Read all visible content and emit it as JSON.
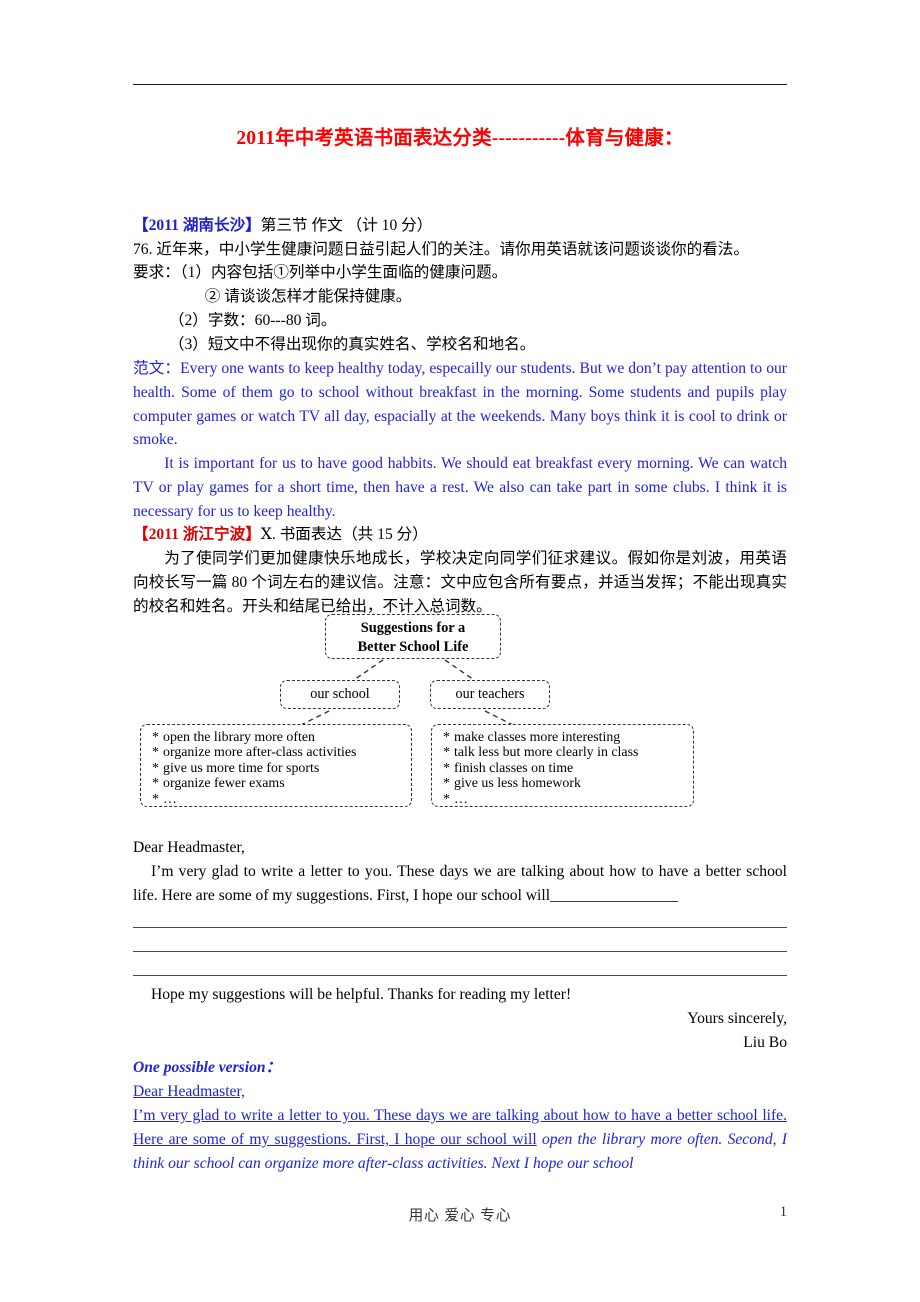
{
  "document": {
    "title": "2011年中考英语书面表达分类-----------体育与健康：",
    "title_color": "#ff0000"
  },
  "section_changsha": {
    "tag": "【2011 湖南长沙】",
    "tag_color": "#1f1fc8",
    "heading_rest": "第三节 作文 （计 10 分）",
    "prompt": "76. 近年来，中小学生健康问题日益引起人们的关注。请你用英语就该问题谈谈你的看法。",
    "req_intro": "要求：（1）内容包括①列举中小学生面临的健康问题。",
    "req_2": "② 请谈谈怎样才能保持健康。",
    "req_3": "（2）字数：60---80 词。",
    "req_4": "（3）短文中不得出现你的真实姓名、学校名和地名。",
    "sample_label": "范文：",
    "sample_para1": "Every one wants to keep healthy today, especailly our students. But we don’t pay attention to our health. Some of them go to school without breakfast in the morning. Some students and pupils play computer games or watch TV all day, espacially at the weekends. Many boys think it is cool to drink or smoke.",
    "sample_para2": "It is important for us to have good habbits. We should eat breakfast every morning. We can watch TV or play games for a short time, then have a rest. We also can take part in some clubs. I think it is necessary for us to keep healthy."
  },
  "section_ningbo": {
    "tag": "【2011 浙江宁波】",
    "tag_color": "#e00000",
    "heading_rest": "Ⅹ. 书面表达（共 15 分）",
    "prompt": "为了使同学们更加健康快乐地成长，学校决定向同学们征求建议。假如你是刘波，用英语向校长写一篇 80 个词左右的建议信。注意：文中应包含所有要点，并适当发挥；不能出现真实的校名和姓名。开头和结尾已给出，不计入总词数。",
    "diagram": {
      "title_line1": "Suggestions for a",
      "title_line2": "Better School Life",
      "node_school": "our school",
      "node_teachers": "our teachers",
      "school_items": [
        "open the library more often",
        "organize more after-class activities",
        "give us more time for sports",
        "organize fewer exams",
        "…"
      ],
      "teacher_items": [
        "make classes more interesting",
        "talk less but more clearly in class",
        "finish classes on time",
        "give us less homework",
        "…"
      ],
      "bullet_marker": "*"
    },
    "letter": {
      "salutation": "Dear Headmaster,",
      "body": "I’m very glad to write a letter to you. These days we are talking about how to have a better school life. Here are some of my suggestions. First, I hope our school will",
      "blank_count": 3,
      "closing_line": "Hope my suggestions will be helpful. Thanks for reading my letter!",
      "sign_off": "Yours sincerely,",
      "sign_name": "Liu Bo"
    },
    "answer": {
      "label": "One possible version：",
      "salutation": "Dear Headmaster,",
      "underlined_part": "I’m very glad to write a letter to you. These days we are talking about how to have a better school life. Here are some of my suggestions. First, I hope our school will",
      "italic_part": "open the library more often. Second, I think our school can organize more after-class activities. Next I hope our school"
    }
  },
  "footer": {
    "center_text": "用心  爱心 专心",
    "page_number": "1"
  }
}
